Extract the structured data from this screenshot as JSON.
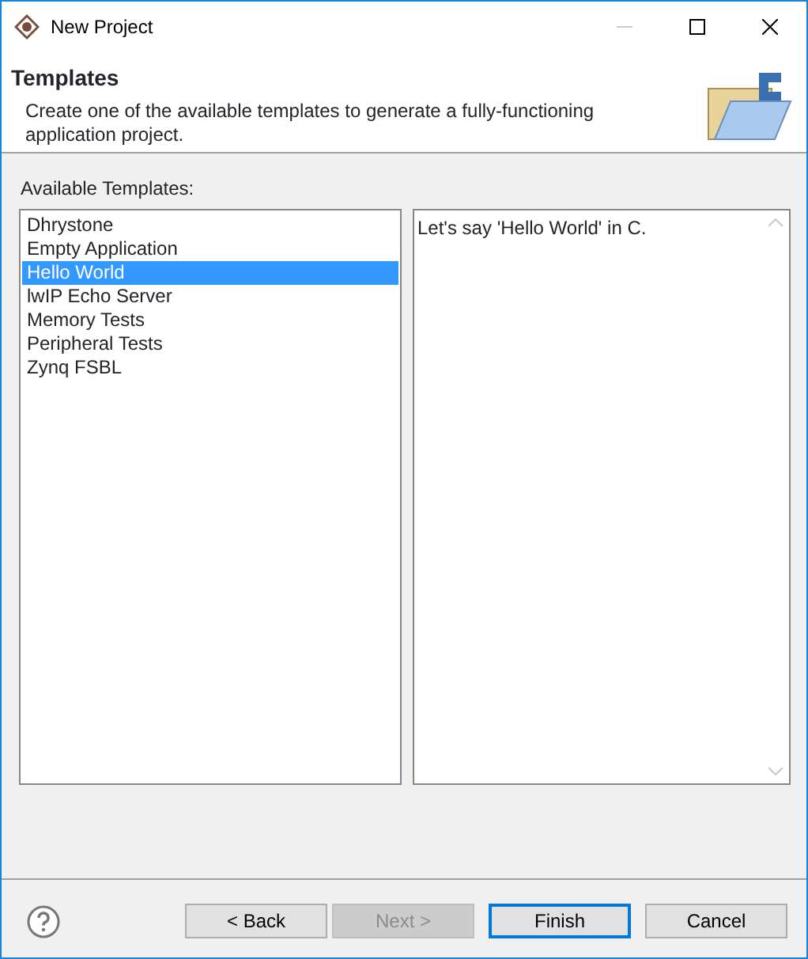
{
  "window": {
    "title": "New Project"
  },
  "header": {
    "title": "Templates",
    "description": "Create one of the available templates to generate a fully-functioning application project."
  },
  "templates_label": "Available Templates:",
  "templates": [
    {
      "label": "Dhrystone",
      "selected": false
    },
    {
      "label": "Empty Application",
      "selected": false
    },
    {
      "label": "Hello World",
      "selected": true
    },
    {
      "label": "lwIP Echo Server",
      "selected": false
    },
    {
      "label": "Memory Tests",
      "selected": false
    },
    {
      "label": "Peripheral Tests",
      "selected": false
    },
    {
      "label": "Zynq FSBL",
      "selected": false
    }
  ],
  "description_text": "Let's say 'Hello World' in C.",
  "buttons": [
    {
      "label": "< Back",
      "disabled": false,
      "default": false
    },
    {
      "label": "Next >",
      "disabled": true,
      "default": false
    },
    {
      "label": "Finish",
      "disabled": false,
      "default": true
    },
    {
      "label": "Cancel",
      "disabled": false,
      "default": false
    }
  ]
}
